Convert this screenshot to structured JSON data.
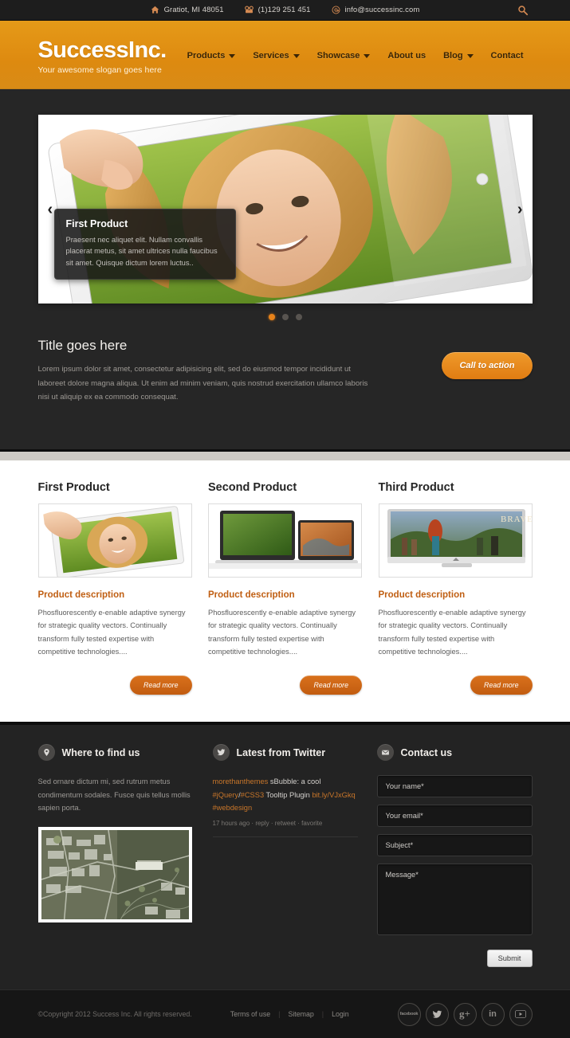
{
  "topbar": {
    "items": [
      {
        "icon": "home-icon",
        "text": "Gratiot, MI 48051"
      },
      {
        "icon": "phone-icon",
        "text": "(1)129 251 451"
      },
      {
        "icon": "email-icon",
        "text": "info@successinc.com"
      }
    ],
    "search_icon": "search-icon"
  },
  "header": {
    "logo": "SuccessInc.",
    "slogan": "Your awesome slogan goes here",
    "nav": [
      {
        "label": "Products",
        "has_caret": true
      },
      {
        "label": "Services",
        "has_caret": true
      },
      {
        "label": "Showcase",
        "has_caret": true
      },
      {
        "label": "About us",
        "has_caret": false
      },
      {
        "label": "Blog",
        "has_caret": true
      },
      {
        "label": "Contact",
        "has_caret": false
      }
    ]
  },
  "slider": {
    "caption_title": "First Product",
    "caption_text": "Praesent nec aliquet elit. Nullam convallis placerat metus, sit amet ultrices nulla faucibus sit amet. Quisque dictum lorem luctus..",
    "prev_arrow": "‹",
    "next_arrow": "›",
    "dots": [
      {
        "active": true
      },
      {
        "active": false
      },
      {
        "active": false
      }
    ]
  },
  "promo": {
    "title": "Title goes here",
    "body": "Lorem ipsum dolor sit amet, consectetur adipisicing elit, sed do eiusmod tempor incididunt ut laboreet dolore magna aliqua. Ut enim ad minim veniam, quis nostrud exercitation ullamco laboris nisi ut aliquip ex ea commodo consequat.",
    "cta_label": "Call to action"
  },
  "products": [
    {
      "title": "First Product",
      "subtitle": "Product description",
      "body": "Phosfluorescently e-enable adaptive synergy for strategic quality vectors. Continually transform fully tested expertise with competitive technologies....",
      "button": "Read more",
      "thumb": "tablet-photo-thumb"
    },
    {
      "title": "Second Product",
      "subtitle": "Product description",
      "body": "Phosfluorescently e-enable adaptive synergy for strategic quality vectors. Continually transform fully tested expertise with competitive technologies....",
      "button": "Read more",
      "thumb": "laptops-thumb"
    },
    {
      "title": "Third Product",
      "subtitle": "Product description",
      "body": "Phosfluorescently e-enable adaptive synergy for strategic quality vectors. Continually transform fully tested expertise with competitive technologies....",
      "button": "Read more",
      "thumb": "desktop-monitor-thumb"
    }
  ],
  "footer": {
    "where": {
      "icon": "location-pin-icon",
      "title": "Where to find us",
      "text": "Sed ornare dictum mi, sed rutrum metus condimentum sodales. Fusce quis tellus mollis sapien porta.",
      "map": "satellite-map-image"
    },
    "twitter": {
      "icon": "twitter-bird-icon",
      "title": "Latest from Twitter",
      "user": "morethanthemes",
      "text_1": " sBubble: a cool ",
      "tag_1": "#jQuery",
      "text_2": "/",
      "tag_2": "#CSS3",
      "text_3": " Tooltip Plugin ",
      "link": "bit.ly/VJxGkq",
      "tag_3": " #webdesign",
      "meta": "17 hours ago · reply · retweet · favorite"
    },
    "contact": {
      "icon": "envelope-icon",
      "title": "Contact us",
      "name_placeholder": "Your name*",
      "email_placeholder": "Your email*",
      "subject_placeholder": "Subject*",
      "message_placeholder": "Message*",
      "submit_label": "Submit"
    }
  },
  "bottombar": {
    "copyright": "©Copyright 2012 Success Inc. All rights reserved.",
    "links": [
      "Terms of use",
      "Sitemap",
      "Login"
    ],
    "separator": "|",
    "socials": [
      {
        "name": "facebook-icon",
        "glyph": "facebook"
      },
      {
        "name": "twitter-icon",
        "glyph": "t"
      },
      {
        "name": "google-plus-icon",
        "glyph": "g+"
      },
      {
        "name": "linkedin-icon",
        "glyph": "in"
      },
      {
        "name": "youtube-icon",
        "glyph": "yt"
      }
    ]
  },
  "colors": {
    "brand_orange": "#e08e12",
    "accent_orange": "#c05f13",
    "dark_bg": "#262626",
    "footer_bg": "#232323"
  }
}
